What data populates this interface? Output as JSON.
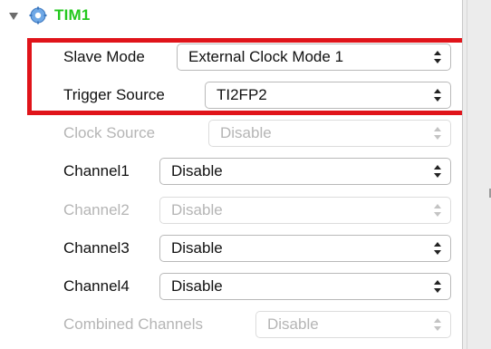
{
  "tree": {
    "title": "TIM1",
    "title_color": "#23c81d",
    "expand_icon": "disclosure-triangle-down",
    "node_icon": "gear-icon"
  },
  "fields": [
    {
      "label": "Slave Mode",
      "value": "External Clock Mode 1",
      "enabled": true
    },
    {
      "label": "Trigger Source",
      "value": "TI2FP2",
      "enabled": true
    },
    {
      "label": "Clock Source",
      "value": "Disable",
      "enabled": false
    },
    {
      "label": "Channel1",
      "value": "Disable",
      "enabled": true
    },
    {
      "label": "Channel2",
      "value": "Disable",
      "enabled": false
    },
    {
      "label": "Channel3",
      "value": "Disable",
      "enabled": true
    },
    {
      "label": "Channel4",
      "value": "Disable",
      "enabled": true
    },
    {
      "label": "Combined Channels",
      "value": "Disable",
      "enabled": false
    }
  ],
  "highlight_color": "#e0141a"
}
